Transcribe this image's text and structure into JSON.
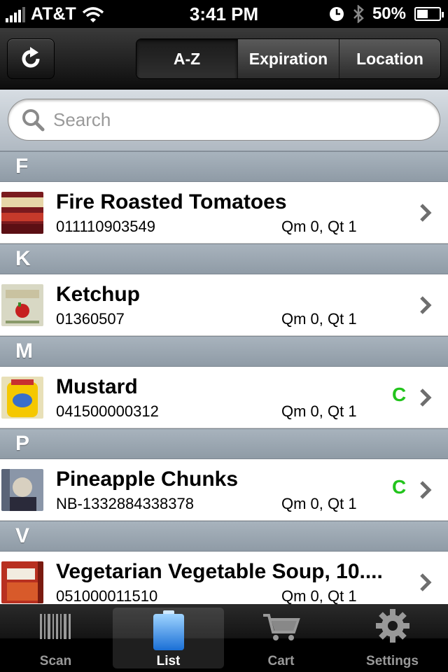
{
  "status_bar": {
    "carrier": "AT&T",
    "time": "3:41 PM",
    "battery": "50%",
    "battery_level": 0.5
  },
  "nav": {
    "segments": [
      "A-Z",
      "Expiration",
      "Location"
    ],
    "selected": "A-Z"
  },
  "search": {
    "placeholder": "Search",
    "value": ""
  },
  "sections": [
    {
      "letter": "F",
      "items": [
        {
          "name": "Fire Roasted Tomatoes",
          "barcode": "011110903549",
          "qty": "Qm 0,  Qt 1",
          "flag": ""
        }
      ]
    },
    {
      "letter": "K",
      "items": [
        {
          "name": "Ketchup",
          "barcode": "01360507",
          "qty": "Qm 0,  Qt 1",
          "flag": ""
        }
      ]
    },
    {
      "letter": "M",
      "items": [
        {
          "name": "Mustard",
          "barcode": "041500000312",
          "qty": "Qm 0,  Qt 1",
          "flag": "C"
        }
      ]
    },
    {
      "letter": "P",
      "items": [
        {
          "name": "Pineapple Chunks",
          "barcode": "NB-1332884338378",
          "qty": "Qm 0,  Qt 1",
          "flag": "C"
        }
      ]
    },
    {
      "letter": "V",
      "items": [
        {
          "name": "Vegetarian Vegetable Soup, 10....",
          "barcode": "051000011510",
          "qty": "Qm 0,  Qt 1",
          "flag": ""
        }
      ]
    }
  ],
  "tab_bar": {
    "tabs": [
      {
        "label": "Scan"
      },
      {
        "label": "List"
      },
      {
        "label": "Cart"
      },
      {
        "label": "Settings"
      }
    ],
    "active": "List"
  },
  "colors": {
    "flag": "#22c41c",
    "section_header": "#9ba6b1"
  }
}
